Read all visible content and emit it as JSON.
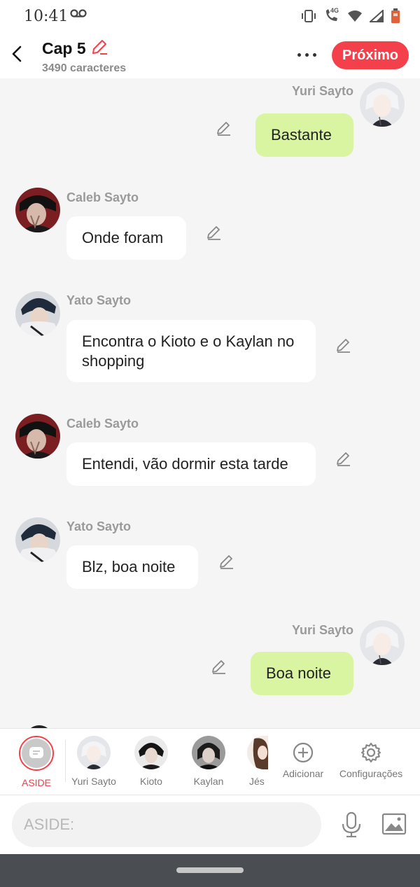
{
  "status_bar": {
    "time": "10:41",
    "network": "4G"
  },
  "header": {
    "title": "Cap 5",
    "subtitle": "3490 caracteres",
    "next_label": "Próximo"
  },
  "messages": [
    {
      "sender": "Yuri Sayto",
      "text": "Bastante",
      "side": "right"
    },
    {
      "sender": "Caleb Sayto",
      "text": "Onde foram",
      "side": "left"
    },
    {
      "sender": "Yato Sayto",
      "text": "Encontra o Kioto e o Kaylan no shopping",
      "side": "left"
    },
    {
      "sender": "Caleb Sayto",
      "text": "Entendi, vão dormir esta tarde",
      "side": "left"
    },
    {
      "sender": "Yato Sayto",
      "text": "Blz, boa noite",
      "side": "left"
    },
    {
      "sender": "Yuri Sayto",
      "text": "Boa noite",
      "side": "right"
    }
  ],
  "characters": [
    {
      "label": "ASIDE",
      "selected": true
    },
    {
      "label": "Yuri Sayto"
    },
    {
      "label": "Kioto"
    },
    {
      "label": "Kaylan"
    },
    {
      "label": "Jés"
    },
    {
      "label": "Adicionar",
      "icon": "add-circle-icon"
    },
    {
      "label": "Configurações",
      "icon": "gear-icon"
    }
  ],
  "input": {
    "placeholder": "ASIDE:"
  },
  "colors": {
    "accent": "#f4404a",
    "my_bubble": "#d9f5a2",
    "other_bubble": "#ffffff",
    "background": "#f5f5f5"
  }
}
